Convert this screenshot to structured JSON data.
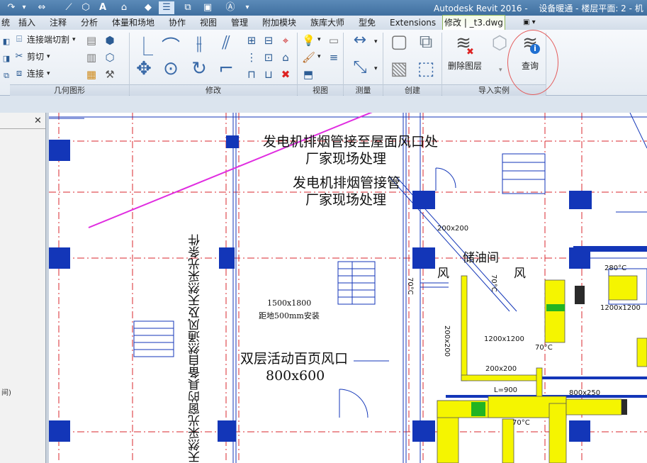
{
  "title_bar": {
    "title": "Autodesk Revit 2016 -",
    "document": "设备暖通 - 楼层平面: 2 - 机"
  },
  "tabs": [
    {
      "label": "统"
    },
    {
      "label": "插入"
    },
    {
      "label": "注释"
    },
    {
      "label": "分析"
    },
    {
      "label": "体量和场地"
    },
    {
      "label": "协作"
    },
    {
      "label": "视图"
    },
    {
      "label": "管理"
    },
    {
      "label": "附加模块"
    },
    {
      "label": "族库大师"
    },
    {
      "label": "型免"
    },
    {
      "label": "Extensions"
    },
    {
      "label": "修改 | _t3.dwg"
    }
  ],
  "ribbon": {
    "geometry": {
      "label": "几何图形",
      "items": [
        "连接端切割",
        "剪切",
        "连接"
      ]
    },
    "modify": {
      "label": "修改"
    },
    "view": {
      "label": "视图"
    },
    "measure": {
      "label": "测量"
    },
    "create": {
      "label": "创建"
    },
    "import_instance": {
      "label": "导入实例",
      "delete_layers": "删除图层",
      "query": "查询"
    }
  },
  "drawing": {
    "notes": [
      "发电机排烟管接至屋面风口处",
      "厂家现场处理",
      "发电机排烟管接管",
      "厂家现场处理",
      "储油间",
      "风",
      "风",
      "双层活动百页风口",
      "800x600",
      "1500x1800",
      "距地500mm安装",
      "天然采光窗的具备自然通风及天然采光条件"
    ],
    "dims": [
      "200x200",
      "1200x1200",
      "200x200",
      "800x250",
      "1200x1200",
      "L=900",
      "200x200",
      "280°C",
      "70°C",
      "70°C",
      "70°C",
      "70°C"
    ]
  },
  "colors": {
    "grid": "#d9272e",
    "column": "#1336b8",
    "duct": "#f5f500",
    "arrow": "#e02ce0",
    "circle": "#e35b5b"
  }
}
